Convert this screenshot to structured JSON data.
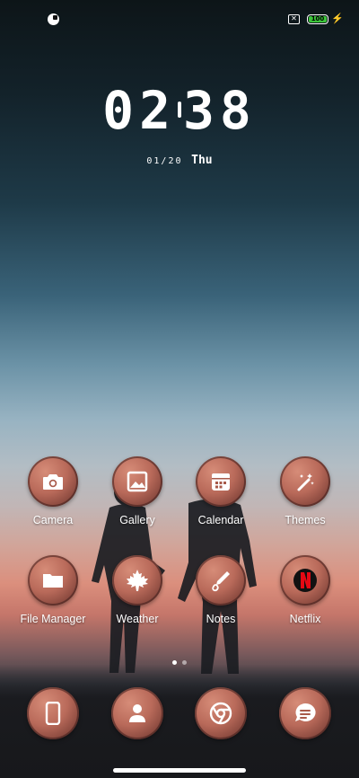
{
  "status_bar": {
    "sim_icon": "sim-x-icon",
    "battery_level": "100",
    "battery_color": "#3cc53a"
  },
  "clock": {
    "hours": "02",
    "minutes": "38",
    "date": "01/20",
    "weekday": "Thu"
  },
  "apps": {
    "camera": "Camera",
    "gallery": "Gallery",
    "calendar": "Calendar",
    "themes": "Themes",
    "file_manager": "File Manager",
    "weather": "Weather",
    "notes": "Notes",
    "netflix": "Netflix"
  },
  "page_indicator": {
    "pages": 2,
    "current": 1
  },
  "dock": [
    "phone-icon",
    "contacts-icon",
    "chrome-icon",
    "messages-icon"
  ],
  "colors": {
    "icon_accent": "#b96a5a",
    "netflix_red": "#e50914"
  }
}
